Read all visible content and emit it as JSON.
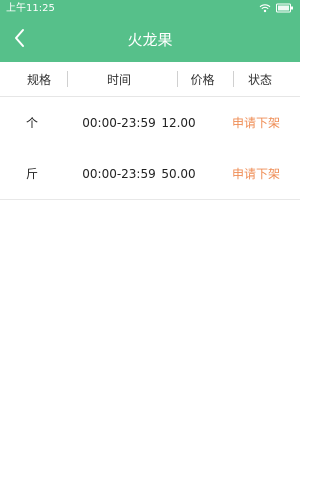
{
  "status_bar": {
    "time": "上午11:25",
    "icons": [
      "wifi-icon",
      "battery-icon"
    ]
  },
  "nav": {
    "back_icon": "chevron-left-icon",
    "title": "火龙果"
  },
  "colors": {
    "header_bg": "#56c08a",
    "status_action": "#ef8d55"
  },
  "table": {
    "headers": {
      "spec": "规格",
      "time": "时间",
      "price": "价格",
      "status": "状态"
    },
    "rows": [
      {
        "spec": "个",
        "time": "00:00-23:59",
        "price": "12.00",
        "action": "申请下架"
      },
      {
        "spec": "斤",
        "time": "00:00-23:59",
        "price": "50.00",
        "action": "申请下架"
      }
    ]
  }
}
